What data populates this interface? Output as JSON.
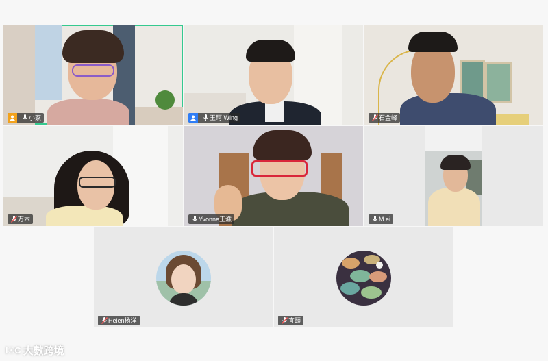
{
  "meeting": {
    "participants": [
      {
        "name": "小家",
        "host": true,
        "host_color": "orange",
        "mic": "on",
        "active": true
      },
      {
        "name": "玉珂 Wing",
        "host": true,
        "host_color": "blue",
        "mic": "on",
        "active": false
      },
      {
        "name": "石金峰",
        "host": false,
        "mic": "muted",
        "active": false
      },
      {
        "name": "万木",
        "host": false,
        "mic": "muted",
        "active": false
      },
      {
        "name": "Yvonne王滋",
        "host": false,
        "mic": "on",
        "active": false
      },
      {
        "name": "M ei",
        "host": false,
        "mic": "on",
        "active": false
      },
      {
        "name": "Helen杨洋",
        "host": false,
        "mic": "muted",
        "avatar": "portrait-avatar",
        "active": false
      },
      {
        "name": "宜頤",
        "host": false,
        "mic": "muted",
        "avatar": "lily-pads-avatar",
        "active": false
      }
    ],
    "colors": {
      "active_border": "#35c98f",
      "host_orange": "#f3a21b",
      "host_blue": "#2f7df6"
    }
  },
  "watermark": {
    "logo": "ꟷ​Co",
    "text": "大數跨境"
  }
}
